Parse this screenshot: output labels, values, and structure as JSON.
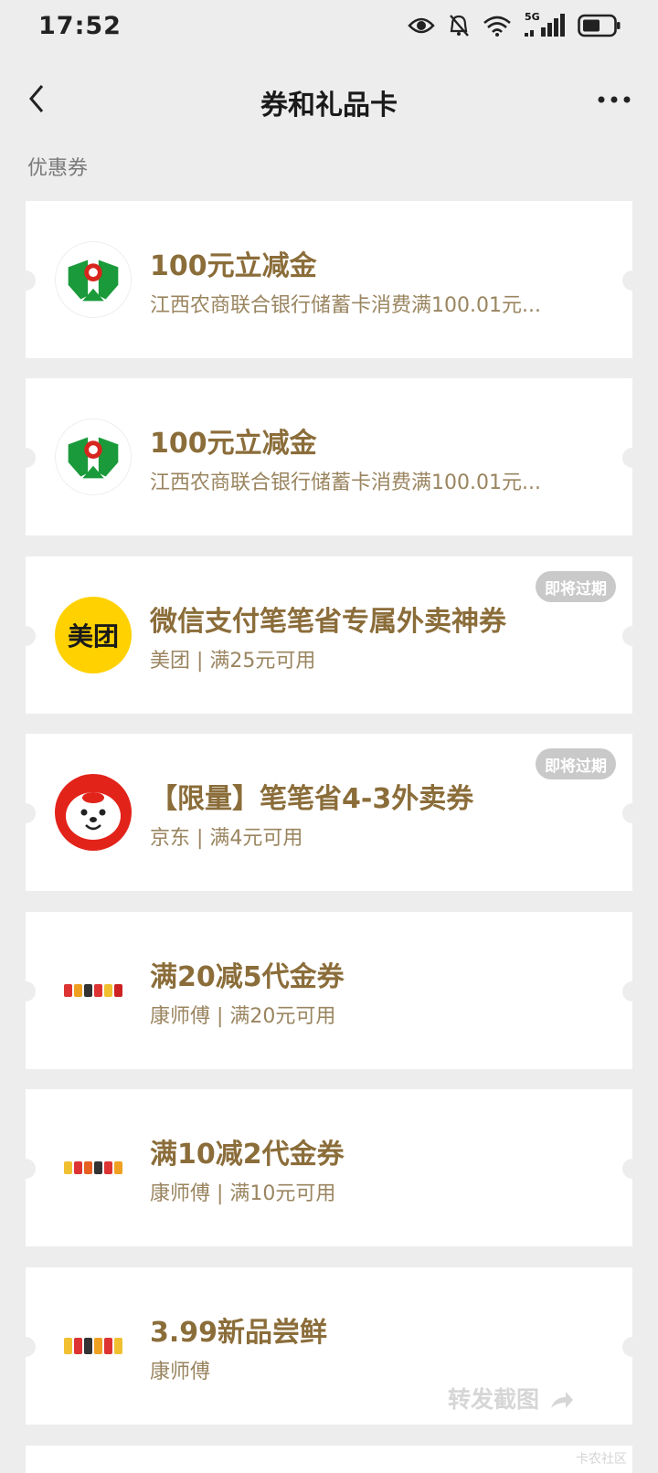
{
  "status_bar": {
    "time": "17:52",
    "network": "5G"
  },
  "nav": {
    "title": "券和礼品卡"
  },
  "section": {
    "title": "优惠券"
  },
  "coupons": [
    {
      "title": "100元立减金",
      "desc": "江西农商联合银行储蓄卡消费满100.01元...",
      "logo": "bank-logo-icon"
    },
    {
      "title": "100元立减金",
      "desc": "江西农商联合银行储蓄卡消费满100.01元...",
      "logo": "bank-logo-icon"
    },
    {
      "title": "微信支付笔笔省专属外卖神券",
      "desc": "美团 | 满25元可用",
      "badge": "即将过期",
      "logo_text": "美团"
    },
    {
      "title": "【限量】笔笔省4-3外卖券",
      "desc": "京东 | 满4元可用",
      "badge": "即将过期",
      "logo": "jd-mascot-icon"
    },
    {
      "title": "满20减5代金券",
      "desc": "康师傅 | 满20元可用",
      "logo": "noodle-products-icon"
    },
    {
      "title": "满10减2代金券",
      "desc": "康师傅 | 满10元可用",
      "logo": "noodle-products-icon"
    },
    {
      "title": "3.99新品尝鲜",
      "desc": "康师傅",
      "logo": "noodle-products-icon"
    }
  ],
  "watermarks": {
    "share": "转发截图",
    "forum": "卡农社区"
  },
  "colors": {
    "background": "#ededed",
    "title_gold": "#8b6d3a",
    "badge_gray": "#c9c9c9",
    "meituan_yellow": "#ffd100"
  }
}
